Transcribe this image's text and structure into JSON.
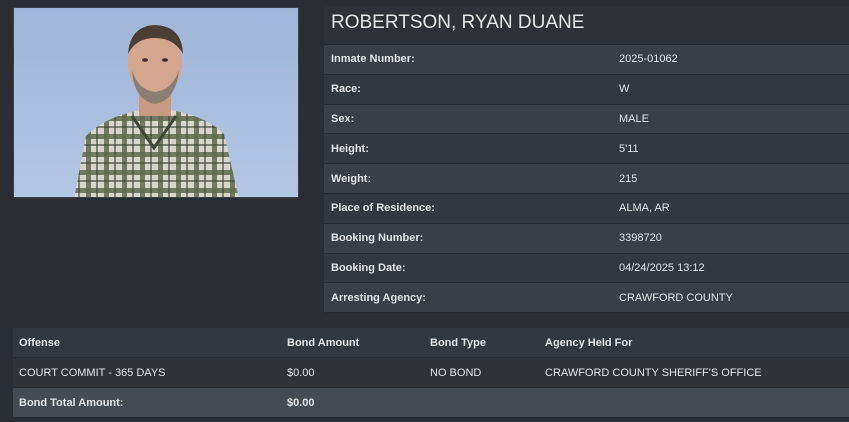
{
  "inmate": {
    "name": "ROBERTSON, RYAN DUANE",
    "photo_icon": "mugshot-photo"
  },
  "details": [
    {
      "label": "Inmate Number:",
      "value": "2025-01062"
    },
    {
      "label": "Race:",
      "value": "W"
    },
    {
      "label": "Sex:",
      "value": "MALE"
    },
    {
      "label": "Height:",
      "value": "5'11"
    },
    {
      "label": "Weight:",
      "value": "215"
    },
    {
      "label": "Place of Residence:",
      "value": "ALMA, AR"
    },
    {
      "label": "Booking Number:",
      "value": "3398720"
    },
    {
      "label": "Booking Date:",
      "value": "04/24/2025 13:12"
    },
    {
      "label": "Arresting Agency:",
      "value": "CRAWFORD COUNTY"
    }
  ],
  "offenses": {
    "headers": [
      "Offense",
      "Bond Amount",
      "Bond Type",
      "Agency Held For"
    ],
    "rows": [
      [
        "COURT COMMIT - 365 DAYS",
        "$0.00",
        "NO BOND",
        "CRAWFORD COUNTY SHERIFF'S OFFICE"
      ]
    ],
    "total_label": "Bond Total Amount:",
    "total_value": "$0.00"
  },
  "colors": {
    "background": "#2a2e33",
    "row_odd": "#3a3f45",
    "row_even": "#33383e",
    "photo_backdrop": "#a9bfe0"
  }
}
